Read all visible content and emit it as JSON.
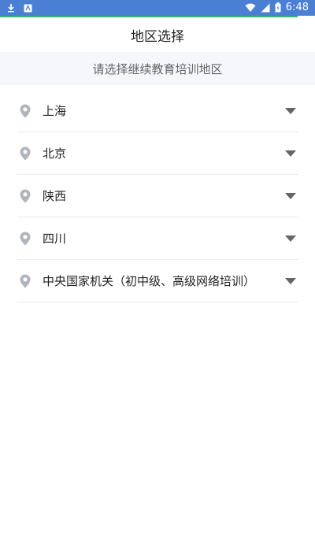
{
  "status_bar": {
    "time": "6:48",
    "icons_left": [
      "download-icon",
      "app-notification-icon"
    ],
    "icons_right": [
      "wifi-icon",
      "cell-signal-icon",
      "battery-icon"
    ]
  },
  "header": {
    "title": "地区选择"
  },
  "subtitle": "请选择继续教育培训地区",
  "regions": [
    {
      "label": "上海"
    },
    {
      "label": "北京"
    },
    {
      "label": "陕西"
    },
    {
      "label": "四川"
    },
    {
      "label": "中央国家机关（初中级、高级网络培训）"
    }
  ],
  "colors": {
    "status_bar": "#4a7fd4",
    "accent_line": "#3cb371",
    "pin": "#b0b4bb",
    "chevron": "#666666"
  }
}
